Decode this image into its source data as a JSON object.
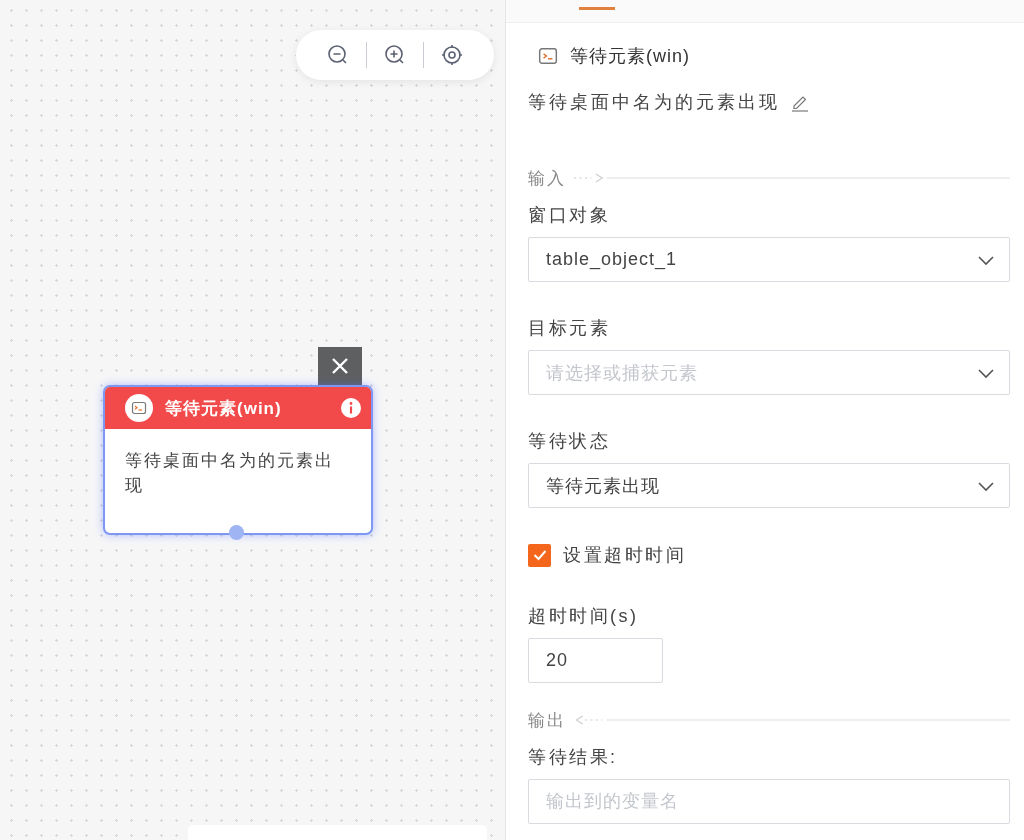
{
  "node": {
    "title": "等待元素(win)",
    "description": "等待桌面中名为的元素出现",
    "selected": true
  },
  "panel": {
    "title": "等待元素(win)",
    "description": "等待桌面中名为的元素出现"
  },
  "form": [
    {
      "kind": "inputs",
      "label": "输入"
    },
    {
      "kind": "select",
      "label": "窗口对象",
      "value": "table_object_1"
    },
    {
      "kind": "select",
      "label": "目标元素",
      "placeholder": "请选择或捕获元素"
    },
    {
      "kind": "select",
      "label": "等待状态",
      "value": "等待元素出现"
    },
    {
      "kind": "checkbox",
      "label": "设置超时时间",
      "checked": true
    },
    {
      "kind": "number",
      "label": "超时时间(s)",
      "value": "20"
    },
    {
      "kind": "outputs",
      "label": "输出"
    },
    {
      "kind": "text",
      "label": "等待结果:",
      "placeholder": "输出到的变量名"
    }
  ]
}
